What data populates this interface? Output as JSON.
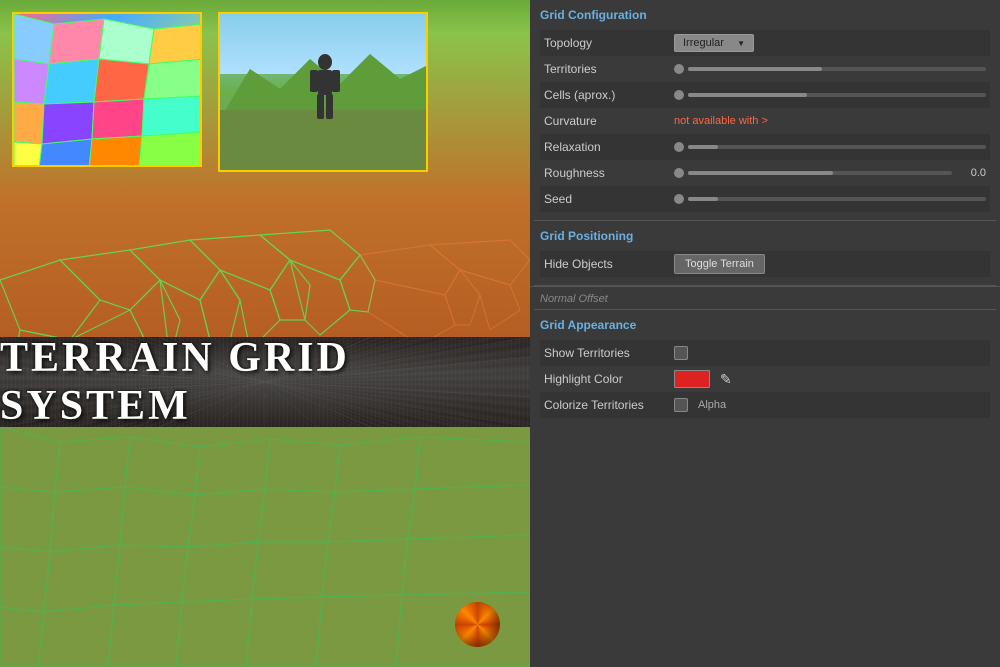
{
  "title_banner": {
    "text": "Terrain Grid System"
  },
  "right_panel": {
    "grid_config": {
      "header": "Grid Configuration",
      "rows": [
        {
          "label": "Topology",
          "type": "dropdown",
          "value": "Irregular"
        },
        {
          "label": "Territories",
          "type": "slider",
          "fill_pct": 45,
          "value": ""
        },
        {
          "label": "Cells (aprox.)",
          "type": "slider",
          "fill_pct": 40,
          "value": ""
        },
        {
          "label": "Curvature",
          "type": "not_available",
          "value": "not available with >"
        },
        {
          "label": "Relaxation",
          "type": "slider",
          "fill_pct": 10,
          "value": ""
        },
        {
          "label": "Roughness",
          "type": "slider",
          "fill_pct": 55,
          "value": "0.0"
        },
        {
          "label": "Seed",
          "type": "slider",
          "fill_pct": 10,
          "value": ""
        }
      ]
    },
    "grid_positioning": {
      "header": "Grid Positioning",
      "rows": [
        {
          "label": "Hide Objects",
          "type": "button",
          "value": "Toggle Terrain"
        }
      ]
    },
    "normal_offset": {
      "label": "Normal Offset"
    },
    "grid_appearance": {
      "header": "Grid Appearance",
      "rows": [
        {
          "label": "Show Territories",
          "type": "checkbox",
          "checked": false
        },
        {
          "label": "Highlight Color",
          "type": "color",
          "color": "#dd2222"
        },
        {
          "label": "Colorize Territories",
          "type": "checkbox_alpha",
          "checked": false,
          "extra": "Alpha"
        }
      ]
    }
  }
}
